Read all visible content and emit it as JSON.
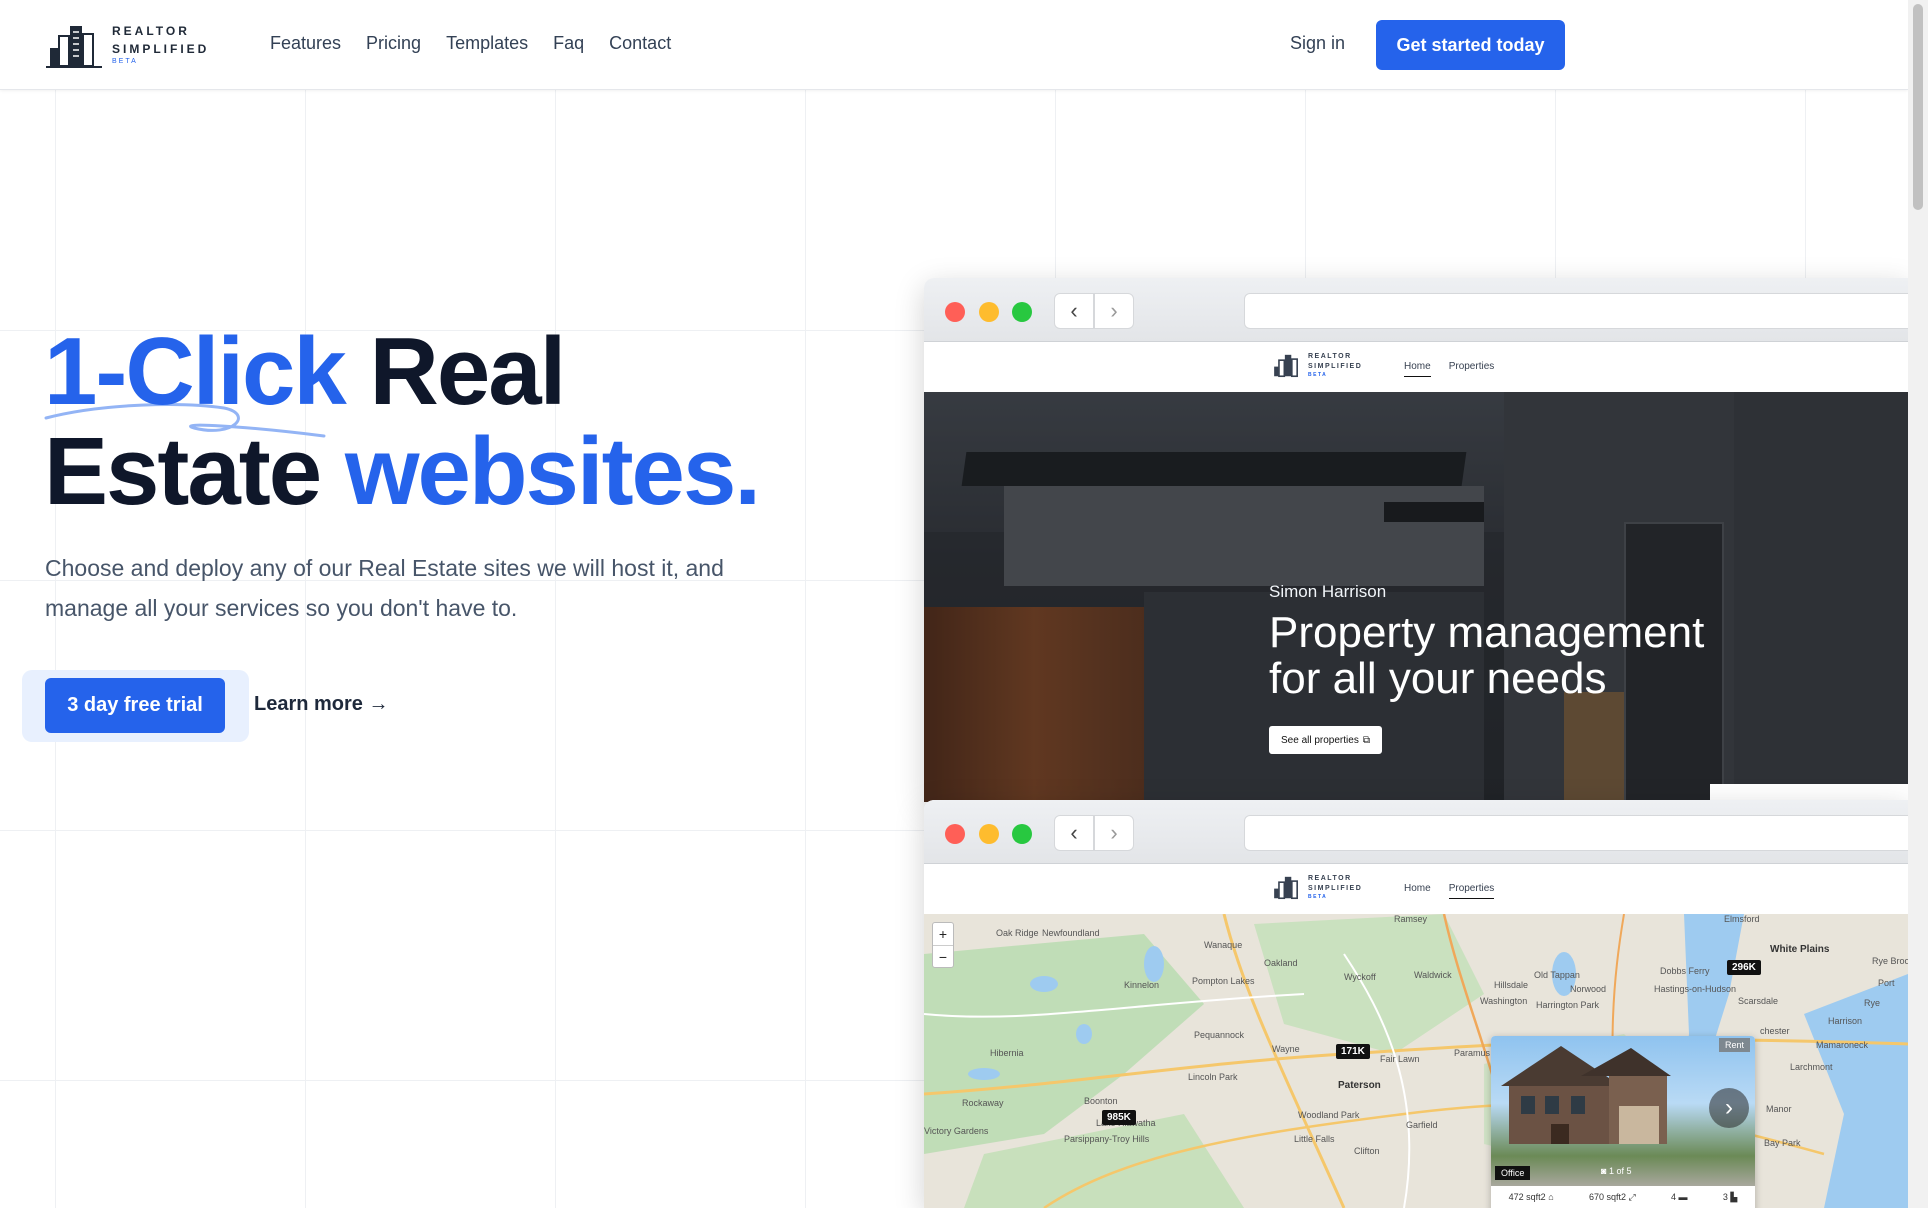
{
  "header": {
    "logo": {
      "line1": "REALTOR",
      "line2": "SIMPLIFIED",
      "badge": "BETA"
    },
    "nav": [
      "Features",
      "Pricing",
      "Templates",
      "Faq",
      "Contact"
    ],
    "signin": "Sign in",
    "cta": "Get started today"
  },
  "hero": {
    "title_part1": "1-Click",
    "title_part2": " Real",
    "title_part3": "Estate ",
    "title_part4": "websites.",
    "subtitle": "Choose and deploy any of our Real Estate sites we will host it, and manage all your services so you don't have to.",
    "primary_button": "3 day free trial",
    "secondary_button": "Learn more →"
  },
  "preview1": {
    "logo": {
      "line1": "REALTOR",
      "line2": "SIMPLIFIED",
      "badge": "BETA"
    },
    "links": [
      "Home",
      "Properties"
    ],
    "name": "Simon Harrison",
    "headline_1": "Property management",
    "headline_2": "for all your needs",
    "button": "See all properties"
  },
  "preview2": {
    "logo": {
      "line1": "REALTOR",
      "line2": "SIMPLIFIED",
      "badge": "BETA"
    },
    "links": [
      "Home",
      "Properties"
    ],
    "zoom_in": "+",
    "zoom_out": "−",
    "prices": [
      "296K",
      "171K",
      "985K"
    ],
    "places": [
      "Ramsey",
      "Elmsford",
      "White Plains",
      "Oak Ridge",
      "Newfoundland",
      "Wanaque",
      "Oakland",
      "Wyckoff",
      "Waldwick",
      "Old Tappan",
      "Dobbs Ferry",
      "Kinnelon",
      "Pompton Lakes",
      "Hillsdale",
      "Norwood",
      "Hastings-on-Hudson",
      "Washington",
      "Harrington Park",
      "Scarsdale",
      "Pequannock",
      "Wayne",
      "Fair Lawn",
      "Paramus",
      "Hibernia",
      "Lincoln Park",
      "Paterson",
      "Rockaway",
      "Boonton",
      "Woodland Park",
      "Garfield",
      "Lake Hiawatha",
      "Parsippany-Troy Hills",
      "Little Falls",
      "Clifton",
      "Victory Gardens",
      "Rye",
      "Harrison",
      "Mamaroneck",
      "Larchmont",
      "Port",
      "Rye Brook",
      "Manor",
      "Bay Park",
      "chester"
    ],
    "card": {
      "tag_rent": "Rent",
      "tag_office": "Office",
      "photos": "1 of 5",
      "stats": [
        "472 sqft2",
        "670 sqft2",
        "4",
        "3"
      ]
    }
  }
}
